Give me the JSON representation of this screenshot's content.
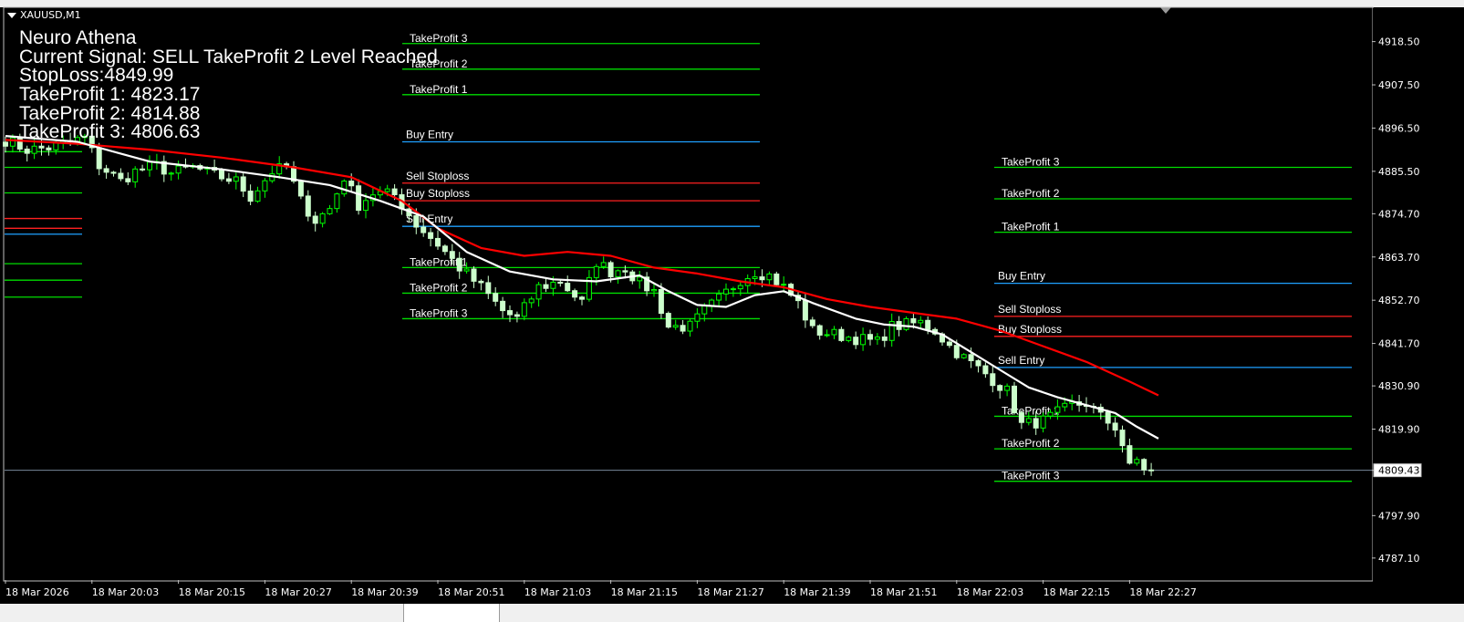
{
  "window": {
    "symbol_label": "XAUUSD,M1"
  },
  "panel": {
    "title": "Neuro Athena",
    "signal": "Current Signal: SELL TakeProfit 2 Level Reached",
    "stoploss": "StopLoss:4849.99",
    "tp1": "TakeProfit 1: 4823.17",
    "tp2": "TakeProfit 2: 4814.88",
    "tp3": "TakeProfit 3: 4806.63"
  },
  "colors": {
    "background": "#000000",
    "bull_candle": "#00ff00",
    "bear_candle": "#ccffcc",
    "ma_fast": "#ffffff",
    "ma_slow": "#ff0000",
    "takeprofit_line": "#00dd00",
    "stoploss_line": "#ff2020",
    "entry_line": "#1ea0ff",
    "bid_line": "#778899"
  },
  "chart_data": {
    "type": "candlestick",
    "symbol": "XAUUSD",
    "timeframe": "M1",
    "ylim": [
      4781.5,
      4927.0
    ],
    "y_ticks": [
      "4918.50",
      "4907.50",
      "4896.50",
      "4885.50",
      "4874.70",
      "4863.70",
      "4852.70",
      "4841.70",
      "4830.90",
      "4819.90",
      "4809.43",
      "4797.90",
      "4787.10"
    ],
    "current_price": "4809.43",
    "x_tick_labels": [
      "18 Mar 2026",
      "18 Mar 20:03",
      "18 Mar 20:15",
      "18 Mar 20:27",
      "18 Mar 20:39",
      "18 Mar 20:51",
      "18 Mar 21:03",
      "18 Mar 21:15",
      "18 Mar 21:27",
      "18 Mar 21:39",
      "18 Mar 21:51",
      "18 Mar 22:03",
      "18 Mar 22:15",
      "18 Mar 22:27"
    ],
    "x_ticks_bar_index": [
      0,
      12,
      24,
      36,
      48,
      60,
      72,
      84,
      96,
      108,
      120,
      132,
      144,
      156
    ],
    "bar_count": 160,
    "price_path": [
      [
        0,
        4893.5
      ],
      [
        3,
        4891.0
      ],
      [
        6,
        4891.5
      ],
      [
        9,
        4893.0
      ],
      [
        11,
        4894.0
      ],
      [
        13,
        4887.0
      ],
      [
        16,
        4883.0
      ],
      [
        18,
        4885.5
      ],
      [
        21,
        4887.0
      ],
      [
        23,
        4885.0
      ],
      [
        26,
        4886.5
      ],
      [
        29,
        4884.5
      ],
      [
        32,
        4883.0
      ],
      [
        34,
        4879.0
      ],
      [
        37,
        4885.5
      ],
      [
        39,
        4886.5
      ],
      [
        41,
        4878.0
      ],
      [
        43,
        4873.0
      ],
      [
        45,
        4876.0
      ],
      [
        47,
        4884.0
      ],
      [
        49,
        4877.0
      ],
      [
        51,
        4880.0
      ],
      [
        54,
        4879.5
      ],
      [
        57,
        4872.0
      ],
      [
        60,
        4867.0
      ],
      [
        63,
        4861.0
      ],
      [
        66,
        4856.0
      ],
      [
        69,
        4850.0
      ],
      [
        71,
        4848.0
      ],
      [
        74,
        4856.0
      ],
      [
        77,
        4857.5
      ],
      [
        80,
        4852.0
      ],
      [
        82,
        4862.5
      ],
      [
        84,
        4860.0
      ],
      [
        86,
        4861.0
      ],
      [
        88,
        4857.0
      ],
      [
        90,
        4855.0
      ],
      [
        92,
        4846.0
      ],
      [
        95,
        4846.0
      ],
      [
        97,
        4850.0
      ],
      [
        99,
        4853.0
      ],
      [
        102,
        4858.0
      ],
      [
        104,
        4860.0
      ],
      [
        106,
        4859.0
      ],
      [
        108,
        4856.0
      ],
      [
        110,
        4852.0
      ],
      [
        112,
        4845.0
      ],
      [
        115,
        4844.0
      ],
      [
        118,
        4843.0
      ],
      [
        121,
        4842.0
      ],
      [
        123,
        4846.0
      ],
      [
        125,
        4846.5
      ],
      [
        127,
        4847.0
      ],
      [
        129,
        4845.0
      ],
      [
        131,
        4841.0
      ],
      [
        133,
        4838.0
      ],
      [
        136,
        4834.0
      ],
      [
        139,
        4829.5
      ],
      [
        141,
        4821.0
      ],
      [
        144,
        4822.0
      ],
      [
        146,
        4824.0
      ],
      [
        148,
        4826.0
      ],
      [
        150,
        4826.5
      ],
      [
        152,
        4823.0
      ],
      [
        154,
        4820.5
      ],
      [
        155,
        4816.0
      ],
      [
        156,
        4810.0
      ],
      [
        157,
        4812.0
      ],
      [
        158,
        4810.0
      ],
      [
        159,
        4809.43
      ]
    ],
    "ma_fast_path": [
      [
        0,
        4894.5
      ],
      [
        10,
        4893.0
      ],
      [
        20,
        4888.0
      ],
      [
        30,
        4886.0
      ],
      [
        38,
        4884.0
      ],
      [
        45,
        4882.0
      ],
      [
        52,
        4878.0
      ],
      [
        58,
        4874.0
      ],
      [
        64,
        4865.0
      ],
      [
        70,
        4860.0
      ],
      [
        76,
        4858.0
      ],
      [
        82,
        4857.5
      ],
      [
        88,
        4859.0
      ],
      [
        92,
        4855.0
      ],
      [
        96,
        4851.5
      ],
      [
        100,
        4851.0
      ],
      [
        104,
        4854.0
      ],
      [
        108,
        4855.0
      ],
      [
        112,
        4852.0
      ],
      [
        118,
        4848.0
      ],
      [
        122,
        4846.5
      ],
      [
        126,
        4846.0
      ],
      [
        130,
        4844.0
      ],
      [
        134,
        4839.5
      ],
      [
        138,
        4835.0
      ],
      [
        142,
        4830.5
      ],
      [
        146,
        4828.0
      ],
      [
        150,
        4826.0
      ],
      [
        154,
        4824.0
      ],
      [
        157,
        4820.5
      ],
      [
        160,
        4817.5
      ]
    ],
    "ma_slow_path": [
      [
        0,
        4893.5
      ],
      [
        10,
        4892.5
      ],
      [
        20,
        4891.0
      ],
      [
        30,
        4889.0
      ],
      [
        40,
        4886.5
      ],
      [
        48,
        4884.0
      ],
      [
        55,
        4878.0
      ],
      [
        60,
        4871.0
      ],
      [
        66,
        4866.0
      ],
      [
        72,
        4864.0
      ],
      [
        78,
        4865.0
      ],
      [
        84,
        4864.0
      ],
      [
        90,
        4861.0
      ],
      [
        96,
        4859.5
      ],
      [
        102,
        4857.5
      ],
      [
        108,
        4856.0
      ],
      [
        114,
        4853.0
      ],
      [
        120,
        4851.0
      ],
      [
        126,
        4849.5
      ],
      [
        132,
        4848.0
      ],
      [
        138,
        4845.0
      ],
      [
        144,
        4841.0
      ],
      [
        150,
        4837.0
      ],
      [
        156,
        4832.0
      ],
      [
        160,
        4828.5
      ]
    ],
    "level_groups": [
      {
        "name": "signal-1",
        "x_from": 0,
        "x_to": 1,
        "labels_shown": false,
        "levels": [
          {
            "label": "TakeProfit 1",
            "price": 4890.5,
            "kind": "tp"
          },
          {
            "label": "TakeProfit 1",
            "price": 4886.5,
            "kind": "tp"
          },
          {
            "label": "TakeProfit 1",
            "price": 4880.0,
            "kind": "tp"
          },
          {
            "label": "Sell Stoploss",
            "price": 4873.5,
            "kind": "sl"
          },
          {
            "label": "Buy Stoploss",
            "price": 4871.0,
            "kind": "sl"
          },
          {
            "label": "Buy Entry",
            "price": 4869.5,
            "kind": "entry"
          },
          {
            "label": "TakeProfit 1",
            "price": 4862.0,
            "kind": "tp"
          },
          {
            "label": "TakeProfit 2",
            "price": 4857.8,
            "kind": "tp"
          },
          {
            "label": "TakeProfit 3",
            "price": 4853.5,
            "kind": "tp"
          }
        ]
      },
      {
        "name": "signal-2",
        "x_from": 2,
        "x_to": 3,
        "labels_shown": true,
        "levels": [
          {
            "label": "TakeProfit 3",
            "price": 4918.0,
            "kind": "tp"
          },
          {
            "label": "TakeProfit 2",
            "price": 4911.5,
            "kind": "tp"
          },
          {
            "label": "TakeProfit 1",
            "price": 4905.0,
            "kind": "tp"
          },
          {
            "label": "Buy Entry",
            "price": 4893.0,
            "kind": "entry"
          },
          {
            "label": "Sell Stoploss",
            "price": 4882.5,
            "kind": "sl"
          },
          {
            "label": "Buy Stoploss",
            "price": 4878.0,
            "kind": "sl"
          },
          {
            "label": "Sell Entry",
            "price": 4871.5,
            "kind": "entry"
          },
          {
            "label": "TakeProfit 1",
            "price": 4861.0,
            "kind": "tp"
          },
          {
            "label": "TakeProfit 2",
            "price": 4854.5,
            "kind": "tp"
          },
          {
            "label": "TakeProfit 3",
            "price": 4848.0,
            "kind": "tp"
          }
        ]
      },
      {
        "name": "signal-3",
        "x_from": 4,
        "x_to": 5,
        "labels_shown": true,
        "levels": [
          {
            "label": "TakeProfit 3",
            "price": 4886.5,
            "kind": "tp"
          },
          {
            "label": "TakeProfit 2",
            "price": 4878.5,
            "kind": "tp"
          },
          {
            "label": "TakeProfit 1",
            "price": 4870.0,
            "kind": "tp"
          },
          {
            "label": "Buy Entry",
            "price": 4857.0,
            "kind": "entry"
          },
          {
            "label": "Sell Stoploss",
            "price": 4848.6,
            "kind": "sl"
          },
          {
            "label": "Buy Stoploss",
            "price": 4843.5,
            "kind": "sl"
          },
          {
            "label": "Sell Entry",
            "price": 4835.6,
            "kind": "entry"
          },
          {
            "label": "TakeProfit 1",
            "price": 4823.17,
            "kind": "tp"
          },
          {
            "label": "TakeProfit 2",
            "price": 4814.88,
            "kind": "tp"
          },
          {
            "label": "TakeProfit 3",
            "price": 4806.63,
            "kind": "tp"
          }
        ]
      }
    ]
  }
}
